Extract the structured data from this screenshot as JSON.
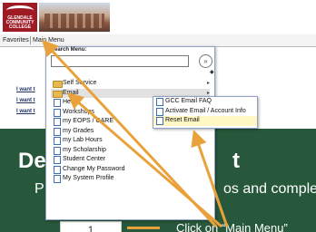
{
  "logo": {
    "text": "GLENDALE COMMUNITY COLLEGE"
  },
  "nav": {
    "favorites": "Favorites",
    "main_menu": "Main Menu"
  },
  "side_links": [
    "I want t",
    "I want t",
    "I want t"
  ],
  "menu": {
    "search_label": "Search Menu:",
    "search_value": "",
    "go_symbol": "»",
    "items": [
      {
        "label": "Self Service",
        "icon": "folder-icon",
        "has_submenu": true
      },
      {
        "label": "Email",
        "icon": "folder-icon",
        "has_submenu": true,
        "selected": true
      },
      {
        "label": "Help",
        "icon": "document-icon"
      },
      {
        "label": "Workshops",
        "icon": "document-icon"
      },
      {
        "label": "my EOPS / CARE",
        "icon": "document-icon"
      },
      {
        "label": "my Grades",
        "icon": "document-icon"
      },
      {
        "label": "my Lab Hours",
        "icon": "document-icon"
      },
      {
        "label": "my Scholarship",
        "icon": "document-icon"
      },
      {
        "label": "Student Center",
        "icon": "document-icon"
      },
      {
        "label": "Change My Password",
        "icon": "document-icon"
      },
      {
        "label": "My System Profile",
        "icon": "document-icon"
      }
    ]
  },
  "submenu": {
    "items": [
      {
        "label": "GCC Email FAQ"
      },
      {
        "label": "Activate Email / Account Info"
      },
      {
        "label": "Reset Email",
        "highlighted": true
      }
    ]
  },
  "banner": {
    "line1_left": "De",
    "line1_right": "t",
    "line2_left": "P",
    "line2_right": "os and comple",
    "step_number": "1",
    "instruction": "Click on “Main Menu”"
  },
  "colors": {
    "banner": "#28583b",
    "annotation_arrow": "#e9a23b",
    "logo": "#9e1b24"
  }
}
